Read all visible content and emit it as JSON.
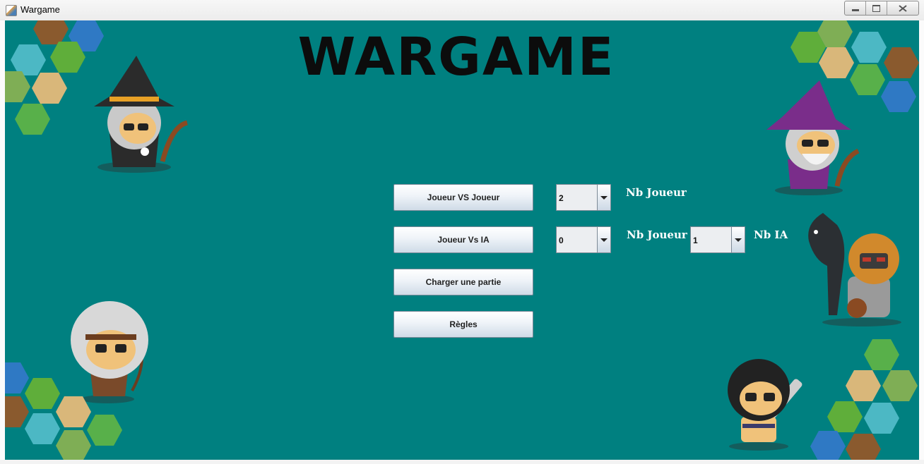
{
  "window": {
    "title": "Wargame"
  },
  "header": {
    "title": "WARGAME"
  },
  "menu": {
    "pvp_button": "Joueur VS Joueur",
    "pvai_button": "Joueur Vs IA",
    "load_button": "Charger une partie",
    "rules_button": "Règles"
  },
  "pvp": {
    "players_value": "2",
    "players_label": "Nb Joueur"
  },
  "pvai": {
    "players_value": "0",
    "players_label": "Nb Joueur",
    "ai_value": "1",
    "ai_label": "Nb IA"
  },
  "colors": {
    "background": "#008080",
    "title": "#0c0c0c",
    "label": "#ffffff"
  },
  "decorations": [
    "hex-tiles-top-left",
    "witch-character",
    "hex-tiles-top-right",
    "wizard-character",
    "knight-horse-character",
    "archer-character",
    "hex-tiles-bottom-left",
    "warrior-character",
    "hex-tiles-bottom-right"
  ]
}
